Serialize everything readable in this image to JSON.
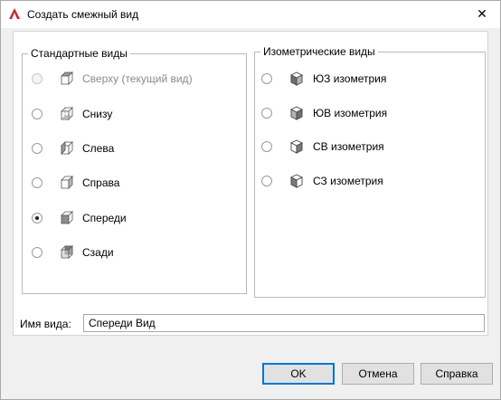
{
  "window": {
    "title": "Создать смежный вид",
    "close_glyph": "✕",
    "accent": "#d71f26"
  },
  "standard": {
    "legend": "Стандартные виды",
    "items": [
      {
        "label": "Сверху (текущий вид)",
        "icon": "top-view-cube-icon",
        "selected": false,
        "enabled": false
      },
      {
        "label": "Снизу",
        "icon": "bottom-view-cube-icon",
        "selected": false,
        "enabled": true
      },
      {
        "label": "Слева",
        "icon": "left-view-cube-icon",
        "selected": false,
        "enabled": true
      },
      {
        "label": "Справа",
        "icon": "right-view-cube-icon",
        "selected": false,
        "enabled": true
      },
      {
        "label": "Спереди",
        "icon": "front-view-cube-icon",
        "selected": true,
        "enabled": true
      },
      {
        "label": "Сзади",
        "icon": "back-view-cube-icon",
        "selected": false,
        "enabled": true
      }
    ]
  },
  "isometric": {
    "legend": "Изометрические виды",
    "items": [
      {
        "label": "ЮЗ изометрия",
        "icon": "sw-iso-cube-icon",
        "selected": false,
        "enabled": true
      },
      {
        "label": "ЮВ изометрия",
        "icon": "se-iso-cube-icon",
        "selected": false,
        "enabled": true
      },
      {
        "label": "СВ изометрия",
        "icon": "ne-iso-cube-icon",
        "selected": false,
        "enabled": true
      },
      {
        "label": "СЗ изометрия",
        "icon": "nw-iso-cube-icon",
        "selected": false,
        "enabled": true
      }
    ]
  },
  "view_name": {
    "label": "Имя вида:",
    "value": "Спереди Вид"
  },
  "buttons": {
    "ok": "OK",
    "cancel": "Отмена",
    "help": "Справка"
  }
}
